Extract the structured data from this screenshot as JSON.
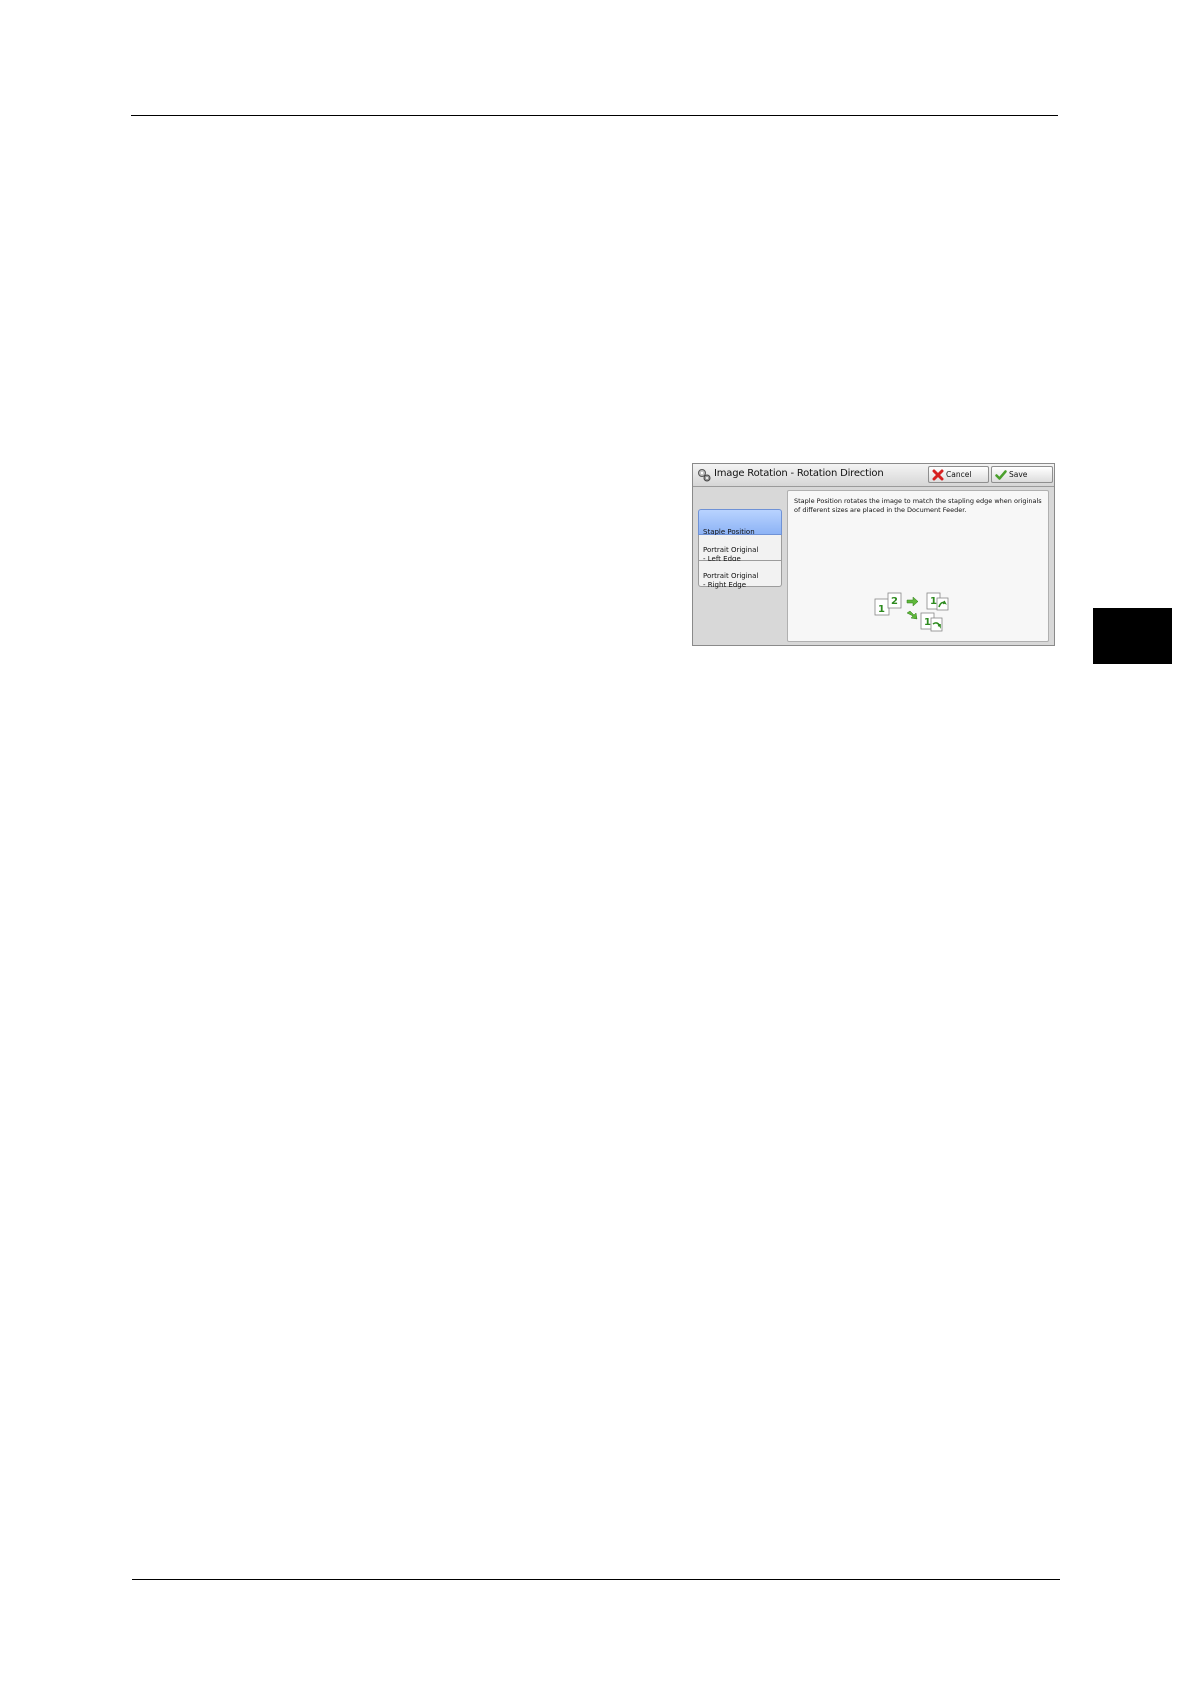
{
  "dialog": {
    "title": "Image Rotation - Rotation Direction",
    "cancel_label": "Cancel",
    "save_label": "Save",
    "options": [
      {
        "label": "Staple Position",
        "selected": true
      },
      {
        "label": "Portrait Original\n- Left Edge",
        "selected": false
      },
      {
        "label": "Portrait Original\n- Right Edge",
        "selected": false
      }
    ],
    "description": "Staple Position rotates the image to match the stapling edge when originals of different sizes are placed in the Document Feeder.",
    "illustration": {
      "page_labels": [
        "1",
        "2",
        "1",
        "1"
      ],
      "icons": [
        "page-icon",
        "arrow-right-icon",
        "arrow-down-right-icon",
        "rotate-icon"
      ]
    }
  },
  "colors": {
    "selected_option": "#9fc0fa",
    "accent_green": "#2e8b1f",
    "cancel_red": "#d62020",
    "chapter_tab": "#000000"
  }
}
